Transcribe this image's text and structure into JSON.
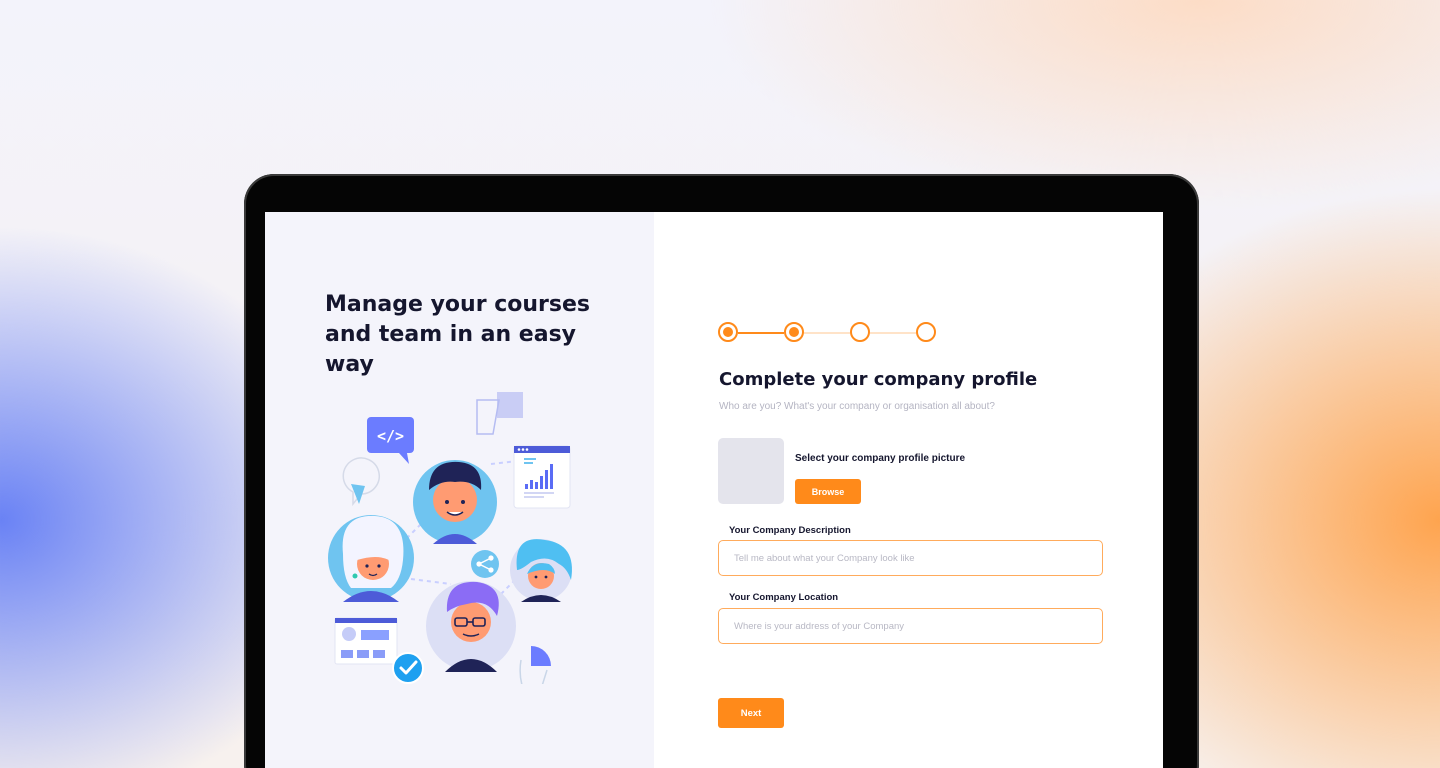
{
  "hero": {
    "headline": "Manage your courses and team in an easy way"
  },
  "illustration": {
    "code_badge": "</>"
  },
  "stepper": {
    "total_steps": 4,
    "completed_steps": 2
  },
  "form": {
    "title": "Complete your company profile",
    "subtitle": "Who are you? What's your company or organisation all about?",
    "picture_label": "Select your company profile picture",
    "browse_label": "Browse",
    "description": {
      "label": "Your Company Description",
      "placeholder": "Tell me about what your Company look like",
      "value": ""
    },
    "location": {
      "label": "Your Company Location",
      "placeholder": "Where is your address of your Company",
      "value": ""
    },
    "next_label": "Next"
  },
  "colors": {
    "accent": "#ff8a1a",
    "heading": "#15162e",
    "illustration_blue": "#6b7cff"
  }
}
